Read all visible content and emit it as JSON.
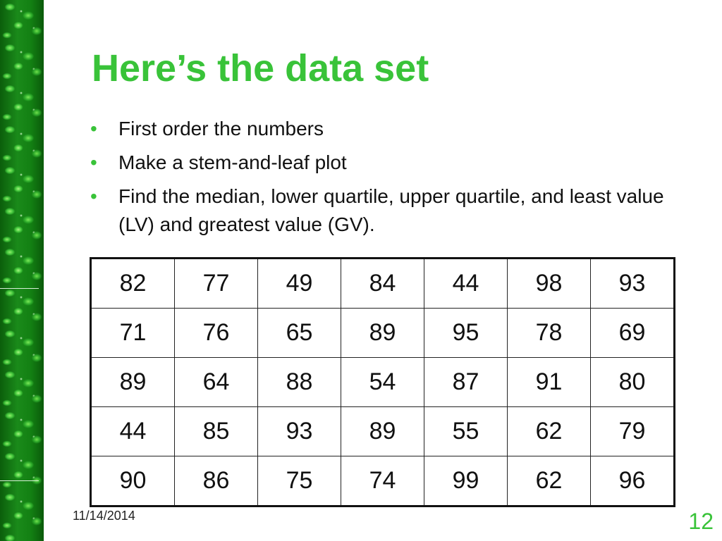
{
  "slide": {
    "title": "Here’s the data set",
    "bullets": [
      "First order the numbers",
      "Make a stem-and-leaf plot",
      "Find the median, lower quartile, upper quartile, and least value (LV) and greatest value (GV)."
    ],
    "bullet_symbol": "•",
    "table": {
      "rows": [
        [
          "82",
          "77",
          "49",
          "84",
          "44",
          "98",
          "93"
        ],
        [
          "71",
          "76",
          "65",
          "89",
          "95",
          "78",
          "69"
        ],
        [
          "89",
          "64",
          "88",
          "54",
          "87",
          "91",
          "80"
        ],
        [
          "44",
          "85",
          "93",
          "89",
          "55",
          "62",
          "79"
        ],
        [
          "90",
          "86",
          "75",
          "74",
          "99",
          "62",
          "96"
        ]
      ]
    },
    "footer": {
      "date": "11/14/2014",
      "page_number": "12"
    },
    "colors": {
      "title": "#39c339",
      "bullet": "#39c339",
      "page_number": "#39c339",
      "border": "#0c6a0c"
    },
    "decorations": {
      "left_border": "green-leaf-pattern"
    }
  }
}
